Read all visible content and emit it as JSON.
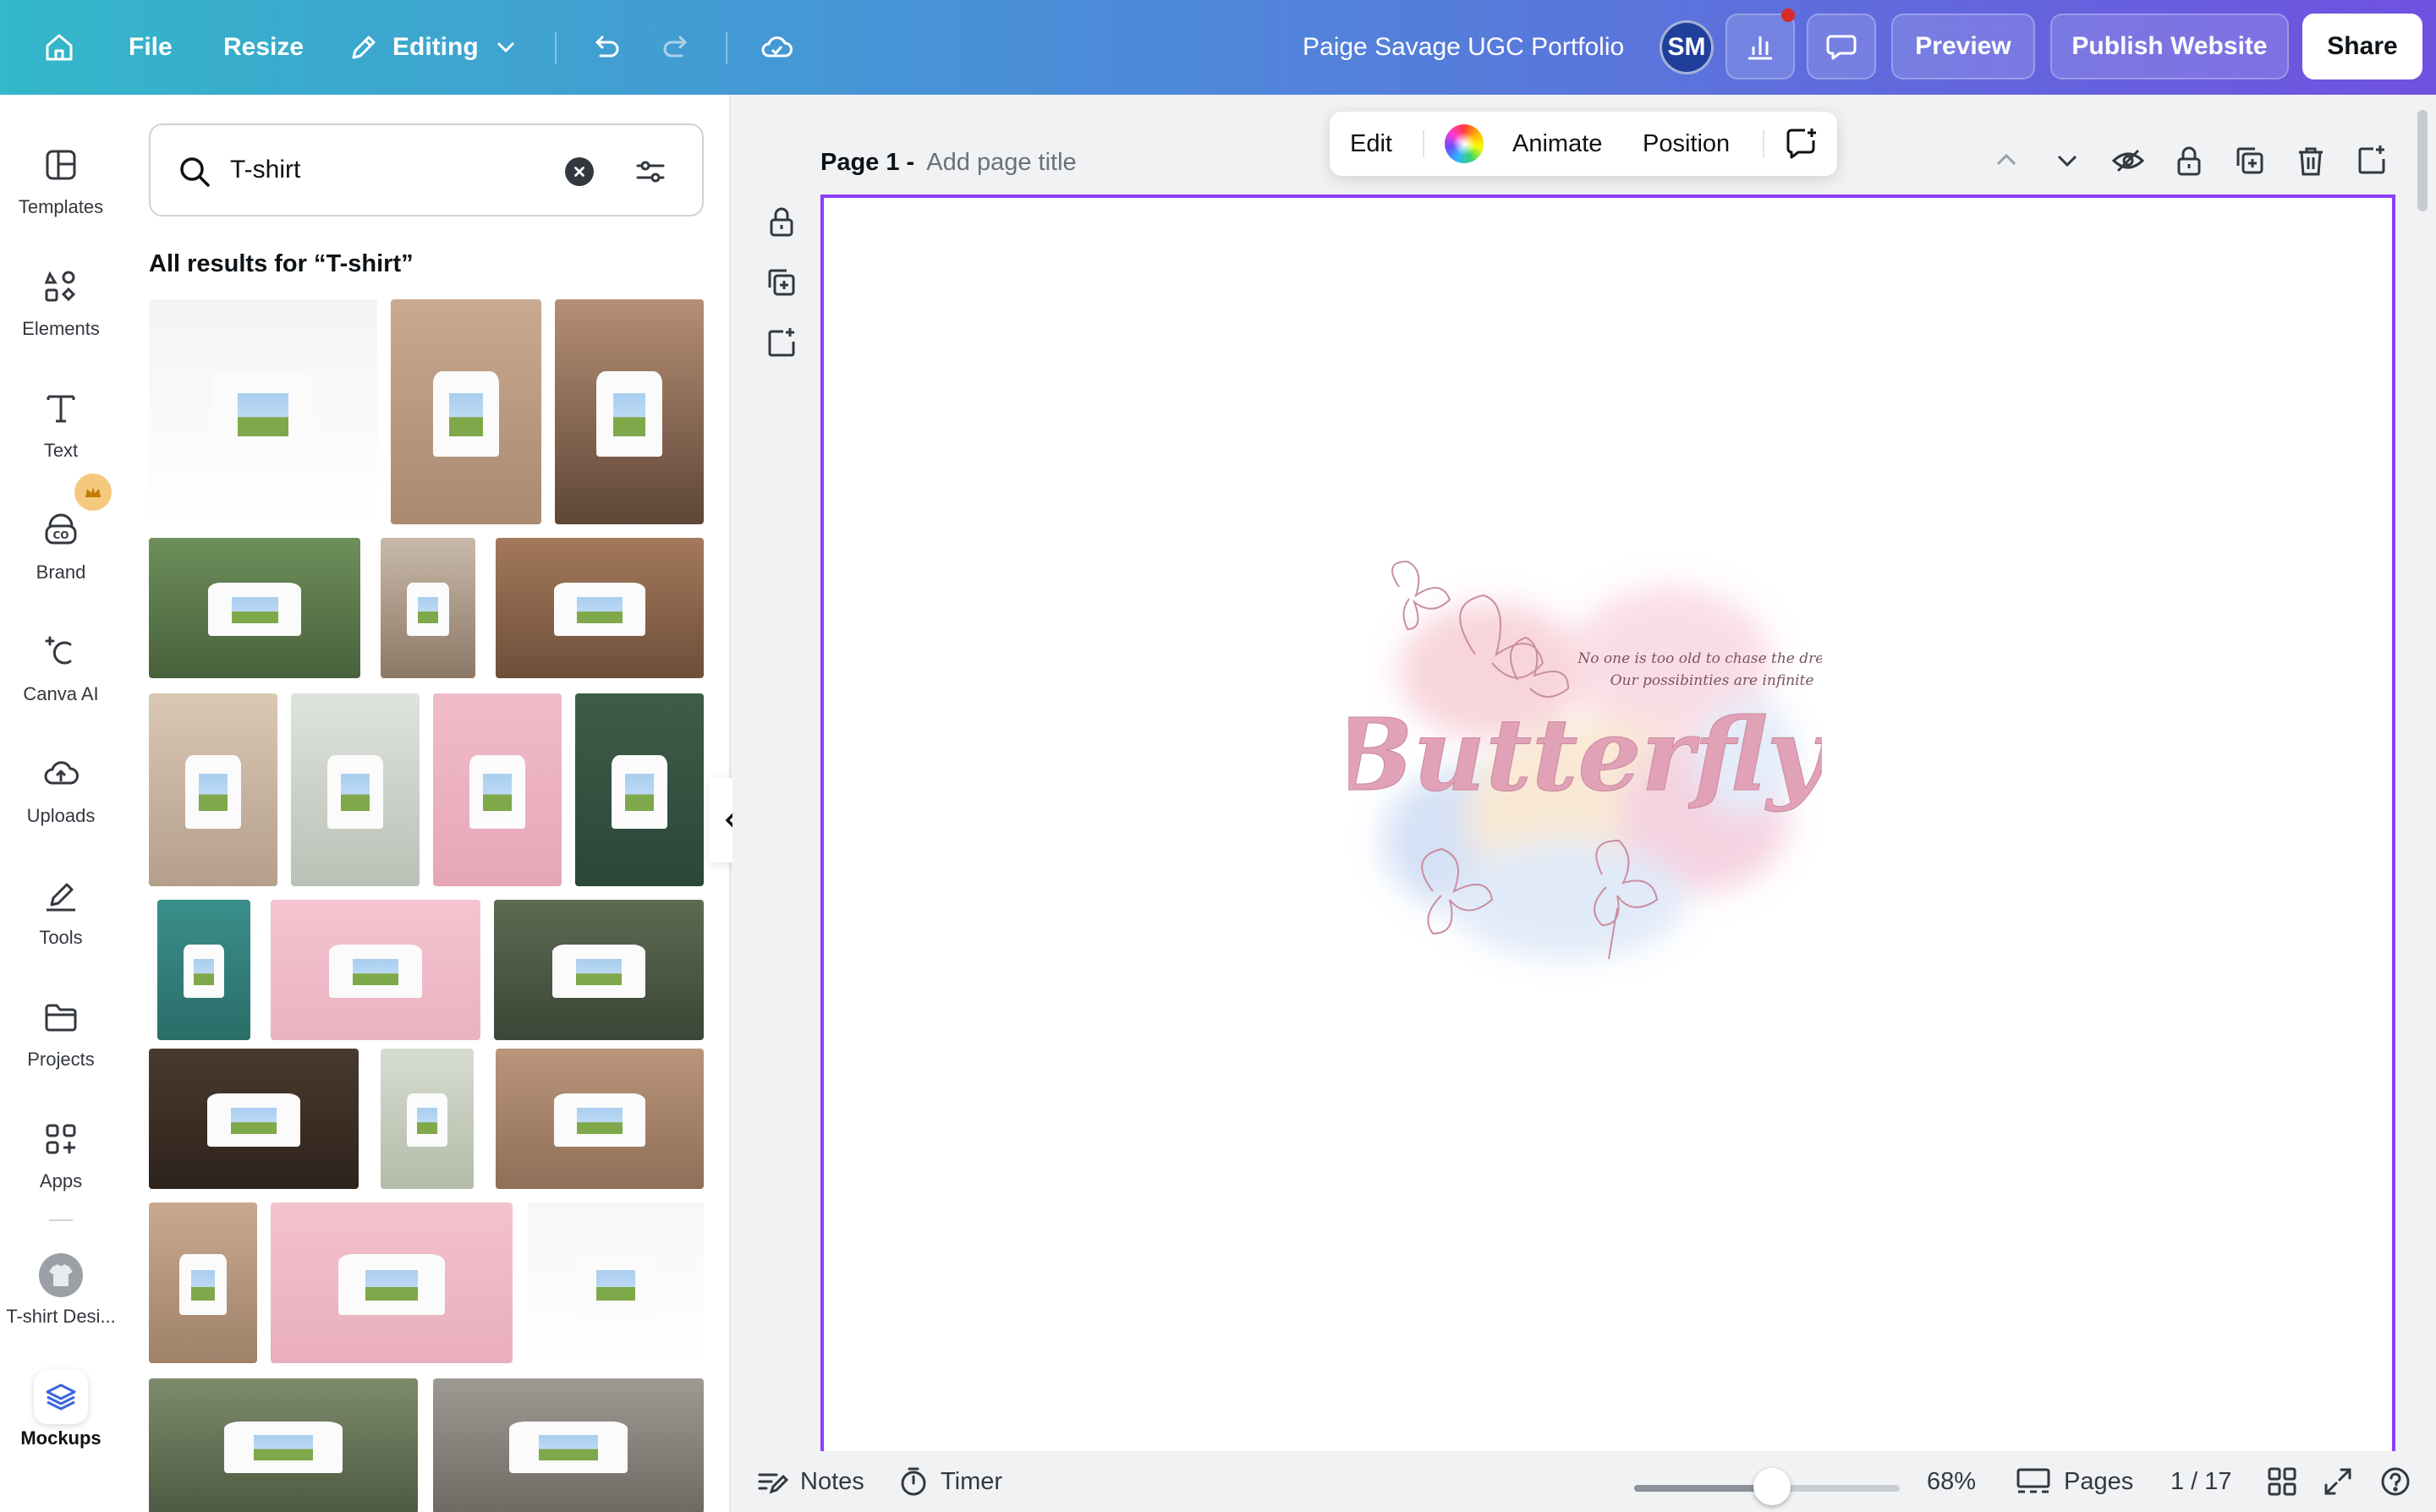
{
  "topbar": {
    "file_label": "File",
    "resize_label": "Resize",
    "editing_label": "Editing",
    "project_title": "Paige Savage UGC Portfolio",
    "avatar_initials": "SM",
    "preview_label": "Preview",
    "publish_label": "Publish Website",
    "share_label": "Share"
  },
  "rail": {
    "items": [
      {
        "label": "Templates"
      },
      {
        "label": "Elements"
      },
      {
        "label": "Text"
      },
      {
        "label": "Brand"
      },
      {
        "label": "Canva AI"
      },
      {
        "label": "Uploads"
      },
      {
        "label": "Tools"
      },
      {
        "label": "Projects"
      },
      {
        "label": "Apps"
      },
      {
        "label": "T-shirt Desi..."
      },
      {
        "label": "Mockups"
      }
    ]
  },
  "search": {
    "value": "T-shirt",
    "results_title": "All results for “T-shirt”"
  },
  "toolbar": {
    "edit_label": "Edit",
    "animate_label": "Animate",
    "position_label": "Position"
  },
  "page": {
    "label": "Page 1 -",
    "title_placeholder": "Add page title"
  },
  "design": {
    "headline": "Butterfly",
    "quote_line1": "No one is too old to chase the dream",
    "quote_line2": "Our possibinties are infinite"
  },
  "bottombar": {
    "notes_label": "Notes",
    "timer_label": "Timer",
    "zoom_value": "68%",
    "zoom_fraction": 0.52,
    "pages_label": "Pages",
    "page_counter": "1 / 17"
  },
  "colors": {
    "accent": "#8b3dff",
    "topbar_start": "#33b7c9",
    "topbar_end": "#6f52e0",
    "avatar": "#1f3f9b",
    "notification": "#d92b2b"
  }
}
